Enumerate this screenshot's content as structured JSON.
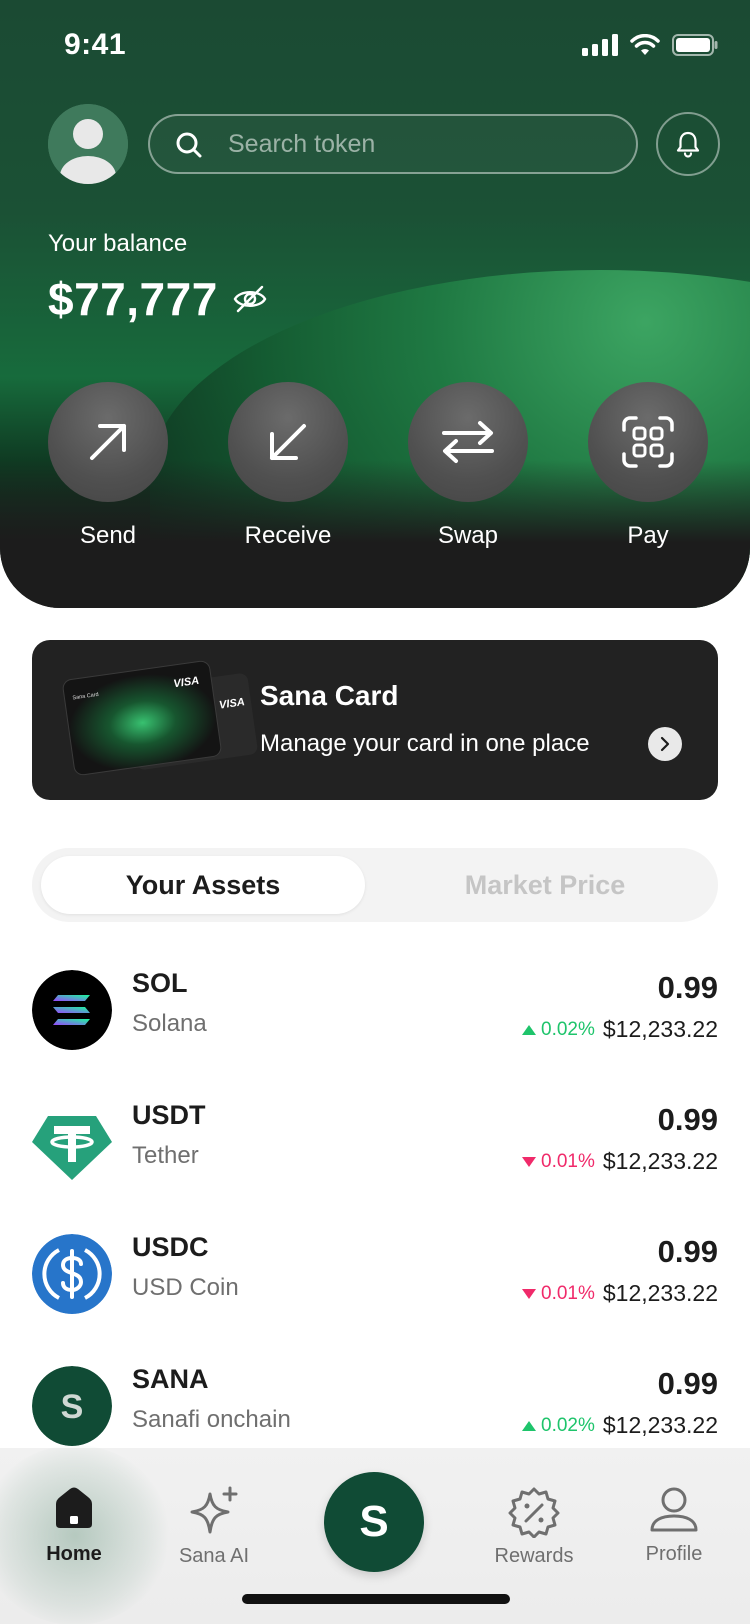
{
  "status_bar": {
    "time": "9:41"
  },
  "header": {
    "search_placeholder": "Search token",
    "balance_label": "Your balance",
    "balance_value": "$77,777"
  },
  "actions": [
    {
      "label": "Send",
      "icon": "arrow-up-right-icon"
    },
    {
      "label": "Receive",
      "icon": "arrow-down-left-icon"
    },
    {
      "label": "Swap",
      "icon": "swap-arrows-icon"
    },
    {
      "label": "Pay",
      "icon": "scan-icon"
    }
  ],
  "card_banner": {
    "title": "Sana Card",
    "subtitle": "Manage your card in one place",
    "card_brand": "VISA",
    "card_name": "Sana Card"
  },
  "tabs": {
    "active": "Your Assets",
    "inactive": "Market Price"
  },
  "assets": [
    {
      "symbol": "SOL",
      "name": "Solana",
      "amount": "0.99",
      "change": "0.02%",
      "direction": "up",
      "usd": "$12,233.22",
      "icon": "solana-icon"
    },
    {
      "symbol": "USDT",
      "name": "Tether",
      "amount": "0.99",
      "change": "0.01%",
      "direction": "down",
      "usd": "$12,233.22",
      "icon": "tether-icon"
    },
    {
      "symbol": "USDC",
      "name": "USD Coin",
      "amount": "0.99",
      "change": "0.01%",
      "direction": "down",
      "usd": "$12,233.22",
      "icon": "usdc-icon"
    },
    {
      "symbol": "SANA",
      "name": "Sanafi onchain",
      "amount": "0.99",
      "change": "0.02%",
      "direction": "up",
      "usd": "$12,233.22",
      "icon": "sana-icon"
    }
  ],
  "nav": {
    "home": "Home",
    "sana_ai": "Sana AI",
    "center": "S",
    "rewards": "Rewards",
    "profile": "Profile"
  },
  "colors": {
    "brand_green": "#104b35",
    "up": "#1ec46b",
    "down": "#f02a6a",
    "card_bg": "#222222"
  }
}
